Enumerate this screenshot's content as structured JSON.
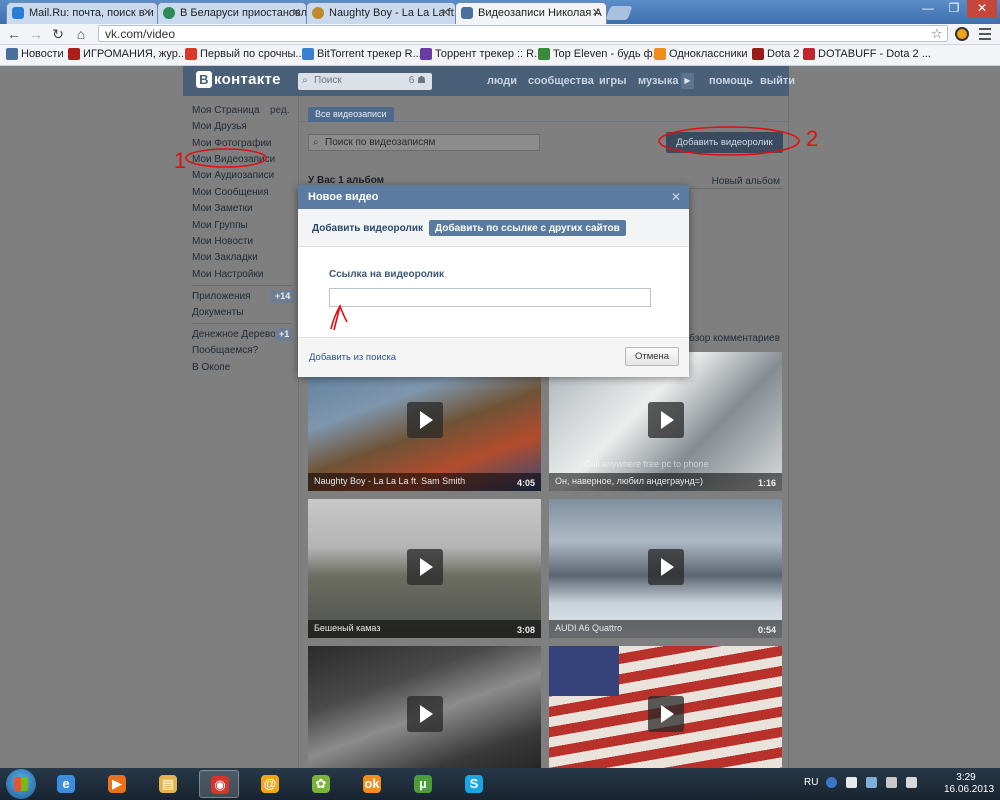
{
  "browser": {
    "tabs": [
      {
        "title": "Mail.Ru: почта, поиск в и",
        "icon": "mailru-icon",
        "icon_color": "#2a7bd4",
        "active": false
      },
      {
        "title": "В Беларуси приостановл",
        "icon": "globe-icon",
        "icon_color": "#2e8b57",
        "active": false
      },
      {
        "title": "Naughty Boy - La La La ft.",
        "icon": "music-icon",
        "icon_color": "#c08a2a",
        "active": false
      },
      {
        "title": "Видеозаписи Николая А",
        "icon": "vk-icon",
        "icon_color": "#4a6f9c",
        "active": true
      }
    ],
    "url": "vk.com/video",
    "bookmarks": [
      {
        "label": "Новости",
        "icon": "vk-icon",
        "color": "#4a6f9c"
      },
      {
        "label": "ИГРОМАНИЯ, жур...",
        "icon": "igromania-icon",
        "color": "#b01c1c"
      },
      {
        "label": "Первый по срочны...",
        "icon": "u-icon",
        "color": "#d83a2a"
      },
      {
        "label": "BitTorrent трекер R...",
        "icon": "torrent-icon",
        "color": "#3b7fd1"
      },
      {
        "label": "Торрент трекер :: R...",
        "icon": "tracker-icon",
        "color": "#6a3aa6"
      },
      {
        "label": "Top Eleven - будь ф...",
        "icon": "football-icon",
        "color": "#3a8a3a"
      },
      {
        "label": "Одноклассники",
        "icon": "ok-icon",
        "color": "#f28c1a"
      },
      {
        "label": "Dota 2",
        "icon": "dota-icon",
        "color": "#9b1b1b"
      },
      {
        "label": "DOTABUFF - Dota 2 ...",
        "icon": "dotabuff-icon",
        "color": "#c0262d"
      }
    ]
  },
  "vk": {
    "logo": "контакте",
    "logo_mark": "В",
    "search_placeholder": "Поиск",
    "search_count": "6",
    "top_nav": [
      "люди",
      "сообщества",
      "игры",
      "музыка",
      "помощь",
      "выйти"
    ],
    "menu": [
      {
        "label": "Моя Страница",
        "extra": "ред."
      },
      {
        "label": "Мои Друзья"
      },
      {
        "label": "Мои Фотографии"
      },
      {
        "label": "Мои Видеозаписи"
      },
      {
        "label": "Мои Аудиозаписи"
      },
      {
        "label": "Мои Сообщения"
      },
      {
        "label": "Мои Заметки"
      },
      {
        "label": "Мои Группы"
      },
      {
        "label": "Мои Новости"
      },
      {
        "label": "Мои Закладки"
      },
      {
        "label": "Мои Настройки"
      }
    ],
    "apps": [
      {
        "label": "Приложения",
        "badge": "+14"
      },
      {
        "label": "Документы"
      }
    ],
    "extra_apps": [
      {
        "label": "Денежное Дерево",
        "badge": "+1"
      },
      {
        "label": "Пообщаемся?"
      },
      {
        "label": "В Окопе"
      }
    ],
    "tab_all": "Все видеозаписи",
    "video_search_placeholder": "Поиск по видеозаписям",
    "add_button": "Добавить видеоролик",
    "albums_title": "У Вас 1 альбом",
    "new_album": "Новый альбом",
    "comments_review": "Обзор комментариев",
    "videos": [
      {
        "title": "Naughty Boy - La La La ft. Sam Smith",
        "duration": "4:05"
      },
      {
        "title": "Он, наверное, любил андеграунд=)",
        "duration": "1:16",
        "watermark": "Call anywhere free pc to phone"
      },
      {
        "title": "Бешеный камаз",
        "duration": "3:08"
      },
      {
        "title": "AUDI A6 Quattro",
        "duration": "0:54"
      },
      {
        "title": "",
        "duration": ""
      },
      {
        "title": "",
        "duration": ""
      }
    ]
  },
  "modal": {
    "title": "Новое видео",
    "tab_upload": "Добавить видеоролик",
    "tab_link": "Добавить по ссылке с других сайтов",
    "field_label": "Ссылка на видеоролик",
    "field_value": "",
    "add_from_search": "Добавить из поиска",
    "cancel": "Отмена"
  },
  "annotations": {
    "label_1": "1",
    "label_2": "2",
    "color": "#e01010"
  },
  "taskbar": {
    "apps": [
      {
        "name": "ie-icon",
        "color": "#3a8ee0",
        "glyph": "e"
      },
      {
        "name": "media-player-icon",
        "color": "#e8731a",
        "glyph": "▶"
      },
      {
        "name": "explorer-icon",
        "color": "#e3b54a",
        "glyph": "▤"
      },
      {
        "name": "chrome-icon",
        "color": "#d6352a",
        "glyph": "◉",
        "active": true
      },
      {
        "name": "mail-agent-icon",
        "color": "#f2a516",
        "glyph": "@"
      },
      {
        "name": "icq-icon",
        "color": "#7ab23a",
        "glyph": "✿"
      },
      {
        "name": "odnoklassniki-icon",
        "color": "#f28c1a",
        "glyph": "ok"
      },
      {
        "name": "utorrent-icon",
        "color": "#4a9d3a",
        "glyph": "µ"
      },
      {
        "name": "skype-icon",
        "color": "#1aa6e4",
        "glyph": "S"
      }
    ],
    "language": "RU",
    "time": "3:29",
    "date": "16.06.2013"
  }
}
